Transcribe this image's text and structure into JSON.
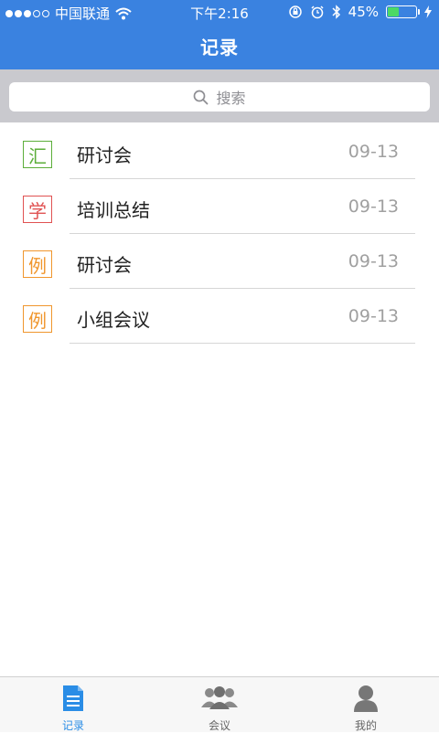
{
  "status_bar": {
    "carrier": "中国联通",
    "time": "下午2:16",
    "battery": "45%",
    "battery_level": 0.45,
    "icons": [
      "signal-dots-icon",
      "wifi-icon",
      "orientation-lock-icon",
      "alarm-icon",
      "bluetooth-icon",
      "battery-icon",
      "charging-icon"
    ]
  },
  "header": {
    "title": "记录",
    "color": "#3a82e0"
  },
  "search": {
    "placeholder": "搜索"
  },
  "records": [
    {
      "badge": "汇",
      "badge_color": "#5cae3a",
      "title": "研讨会",
      "date": "09-13"
    },
    {
      "badge": "学",
      "badge_color": "#e05252",
      "title": "培训总结",
      "date": "09-13"
    },
    {
      "badge": "例",
      "badge_color": "#f0962d",
      "title": "研讨会",
      "date": "09-13"
    },
    {
      "badge": "例",
      "badge_color": "#f0962d",
      "title": "小组会议",
      "date": "09-13"
    }
  ],
  "tabbar": {
    "tabs": [
      {
        "label": "记录",
        "icon": "document-icon",
        "active": true
      },
      {
        "label": "会议",
        "icon": "group-icon",
        "active": false
      },
      {
        "label": "我的",
        "icon": "person-icon",
        "active": false
      }
    ],
    "active_color": "#2a8de6"
  }
}
